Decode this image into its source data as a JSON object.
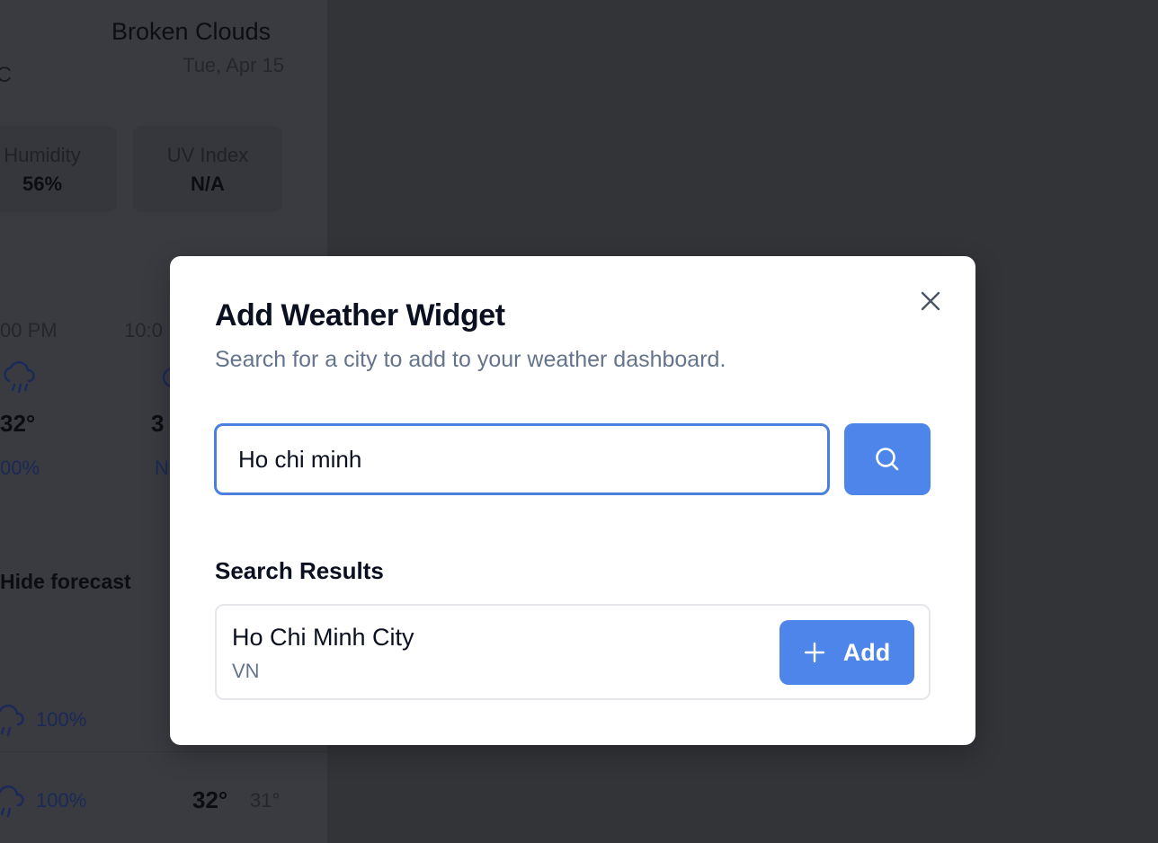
{
  "background": {
    "condition": "Broken Clouds",
    "date": "Tue, Apr 15",
    "temp_unit": "°C",
    "stats": [
      {
        "label": "Humidity",
        "value": "56%"
      },
      {
        "label": "UV Index",
        "value": "N/A"
      }
    ],
    "hourly": [
      {
        "time": "00 PM",
        "temp": "32°",
        "precip": "00%",
        "icon": "cloud-rain-icon"
      },
      {
        "time": "10:0",
        "temp": "3",
        "precip": "N",
        "icon": "cloud-icon"
      }
    ],
    "hide_forecast": "Hide forecast",
    "daily": [
      {
        "precip": "100%",
        "icon": "cloud-rain-icon"
      },
      {
        "precip": "100%",
        "icon": "cloud-rain-icon",
        "high": "32°",
        "low": "31°"
      }
    ]
  },
  "modal": {
    "title": "Add Weather Widget",
    "subtitle": "Search for a city to add to your weather dashboard.",
    "close_icon": "close-icon",
    "search": {
      "value": "Ho chi minh",
      "button_icon": "search-icon"
    },
    "results_heading": "Search Results",
    "results": [
      {
        "city": "Ho Chi Minh City",
        "country": "VN",
        "add_label": "Add",
        "add_icon": "plus-icon"
      }
    ]
  },
  "colors": {
    "overlay": "#333438",
    "accent": "#4e85ea",
    "input_border": "#4a7fe0",
    "muted_text": "#64748b",
    "title_text": "#0b1020"
  }
}
